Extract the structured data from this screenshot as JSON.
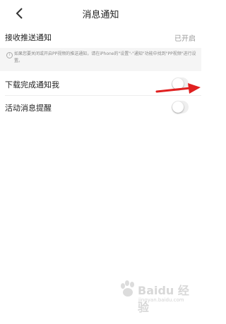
{
  "nav": {
    "title": "消息通知",
    "back_icon": "chevron-left-icon"
  },
  "settings": {
    "push": {
      "label": "接收推送通知",
      "status": "已开启"
    },
    "notice": {
      "icon": "info-icon",
      "text": "如果您要关闭或开启PP视频的推送通知，请在iPhone的\"设置\"-\"通知\"功能中找到\"PP视频\"进行设置。"
    },
    "download_complete": {
      "label": "下载完成通知我",
      "enabled": false
    },
    "activity_reminder": {
      "label": "活动消息提醒",
      "enabled": false
    }
  },
  "annotation": {
    "arrow_color": "#e02020",
    "arrow_icon": "red-arrow-icon"
  },
  "watermark": {
    "text": "Baidu 经验",
    "sub": "jingyan.baidu.com"
  }
}
